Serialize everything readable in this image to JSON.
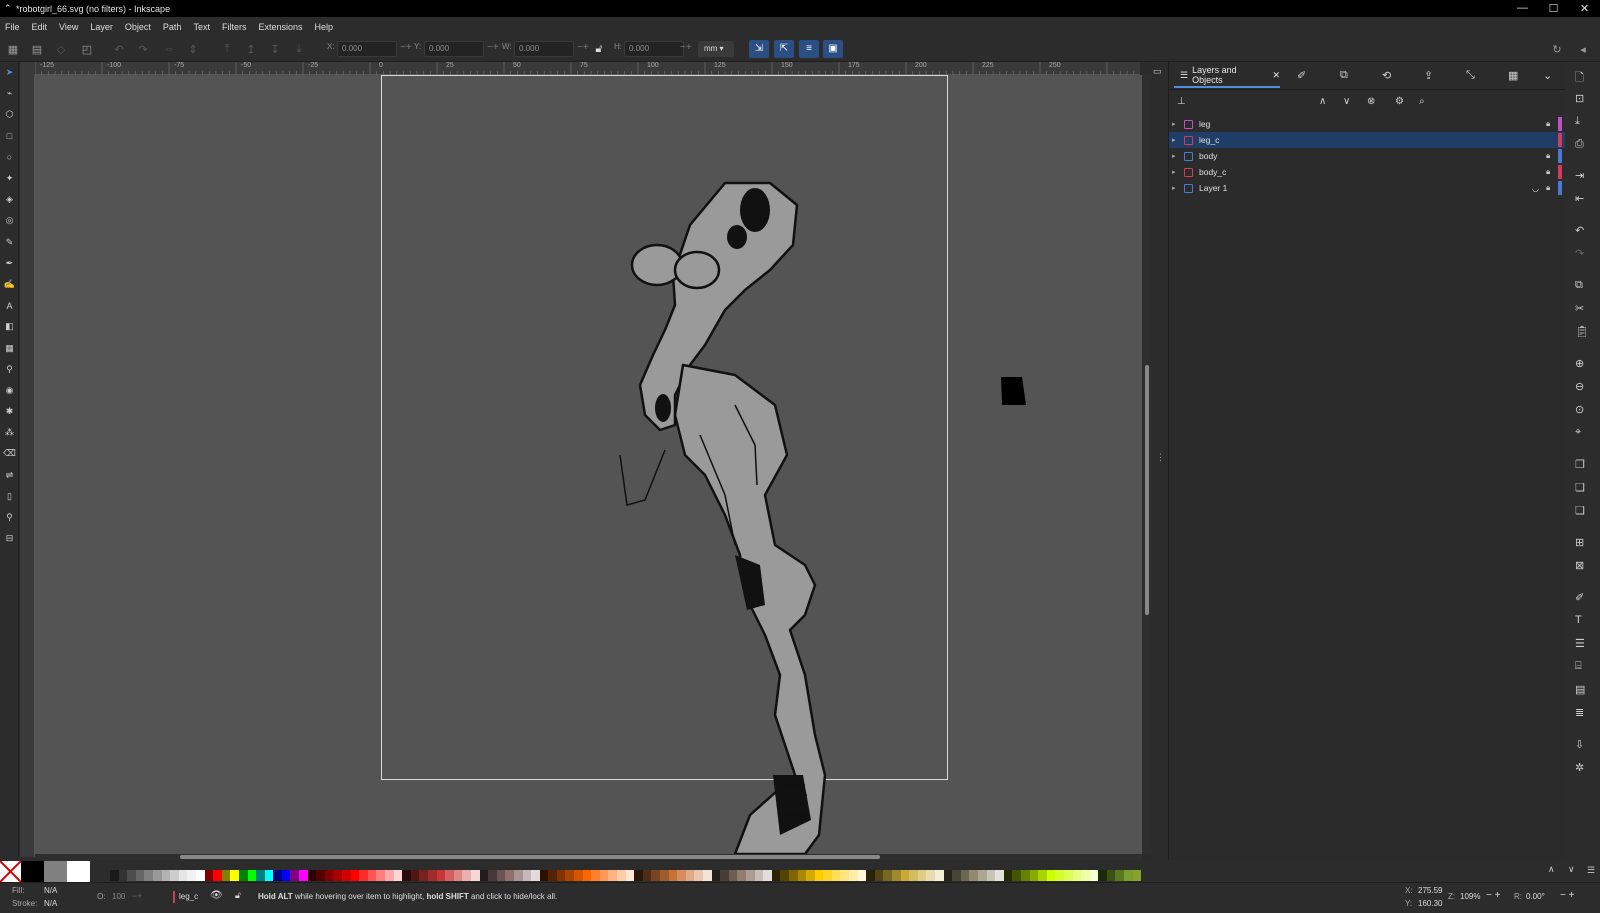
{
  "window": {
    "title": "*robotgirl_66.svg (no filters) - Inkscape",
    "controls": [
      "—",
      "☐",
      "✕"
    ]
  },
  "menu": [
    "File",
    "Edit",
    "View",
    "Layer",
    "Object",
    "Path",
    "Text",
    "Filters",
    "Extensions",
    "Help"
  ],
  "toolbar": {
    "x_label": "X:",
    "x_value": "0.000",
    "y_label": "Y:",
    "y_value": "0.000",
    "w_label": "W:",
    "w_value": "0.000",
    "h_label": "H:",
    "h_value": "0.000",
    "unit": "mm"
  },
  "ruler_top": [
    "-125",
    "-100",
    "-75",
    "-50",
    "-25",
    "0",
    "25",
    "50",
    "75",
    "100",
    "125",
    "150",
    "175",
    "200",
    "225",
    "250"
  ],
  "dock": {
    "active_tab": "Layers and Objects",
    "layers": [
      {
        "name": "leg",
        "color": "#c050c8",
        "locked": true,
        "selected": false,
        "swatch": "#c050c8"
      },
      {
        "name": "leg_c",
        "color": "#d23c5a",
        "locked": false,
        "selected": true,
        "swatch": "#d23c5a"
      },
      {
        "name": "body",
        "color": "#4a7ad8",
        "locked": true,
        "selected": false,
        "swatch": "#4a7ad8"
      },
      {
        "name": "body_c",
        "color": "#d23c5a",
        "locked": true,
        "selected": false,
        "swatch": "#d23c5a"
      },
      {
        "name": "Layer 1",
        "color": "#4a7ad8",
        "locked": true,
        "selected": false,
        "hidden": true,
        "swatch": "#4a7ad8"
      }
    ]
  },
  "status": {
    "fill_label": "Fill:",
    "fill_value": "N/A",
    "stroke_label": "Stroke:",
    "stroke_value": "N/A",
    "opacity_label": "O:",
    "opacity_value": "100",
    "layer": "leg_c",
    "message_bold1": "Hold ALT",
    "message_mid": " while hovering over item to highlight, ",
    "message_bold2": "hold SHIFT",
    "message_end": " and click to hide/lock all.",
    "x_label": "X:",
    "x_value": "275.59",
    "y_label": "Y:",
    "y_value": "160.30",
    "zoom_label": "Z:",
    "zoom_value": "109%",
    "rot_label": "R:",
    "rot_value": "0.00°"
  }
}
